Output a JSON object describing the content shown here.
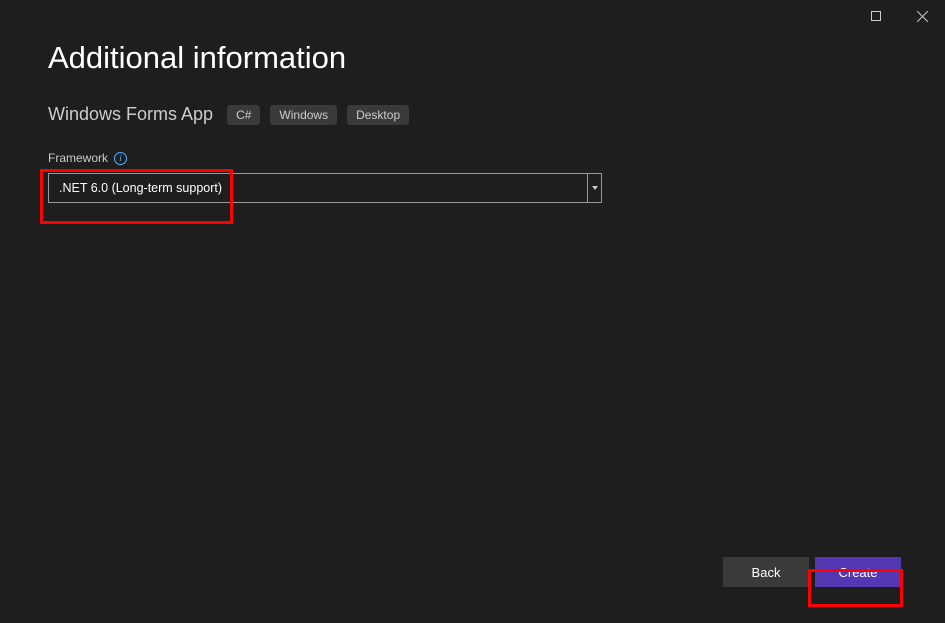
{
  "titlebar": {
    "maximize": "maximize",
    "close": "close"
  },
  "header": {
    "title": "Additional information"
  },
  "project": {
    "name": "Windows Forms App",
    "tags": [
      "C#",
      "Windows",
      "Desktop"
    ]
  },
  "framework": {
    "label": "Framework",
    "selected": ".NET 6.0 (Long-term support)"
  },
  "footer": {
    "back": "Back",
    "create": "Create"
  }
}
